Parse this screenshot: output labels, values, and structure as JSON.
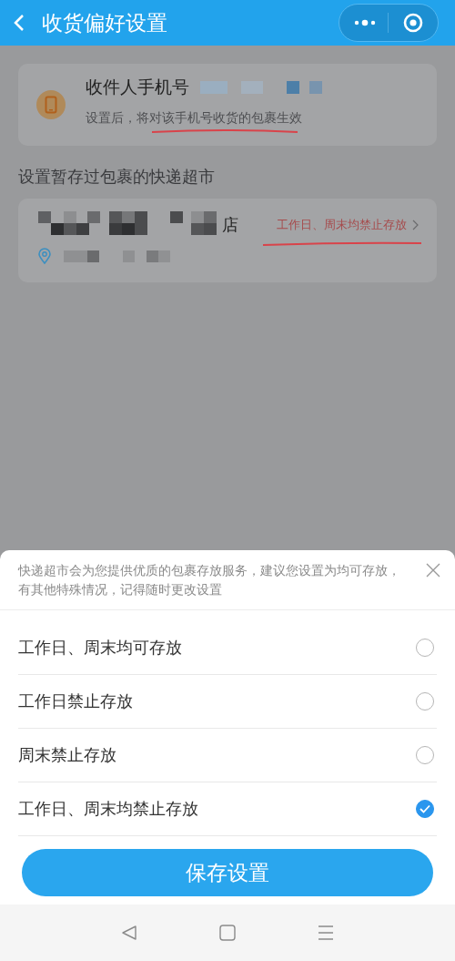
{
  "header": {
    "title": "收货偏好设置"
  },
  "phone_card": {
    "label": "收件人手机号",
    "note": "设置后，将对该手机号收货的包裹生效"
  },
  "section_title": "设置暂存过包裹的快递超市",
  "store_card": {
    "name_visible": "店",
    "status": "工作日、周末均禁止存放"
  },
  "sheet": {
    "message": "快递超市会为您提供优质的包裹存放服务，建议您设置为均可存放，有其他特殊情况，记得随时更改设置",
    "options": [
      {
        "label": "工作日、周末均可存放",
        "selected": false
      },
      {
        "label": "工作日禁止存放",
        "selected": false
      },
      {
        "label": "周末禁止存放",
        "selected": false
      },
      {
        "label": "工作日、周末均禁止存放",
        "selected": true
      }
    ],
    "save_button": "保存设置"
  }
}
